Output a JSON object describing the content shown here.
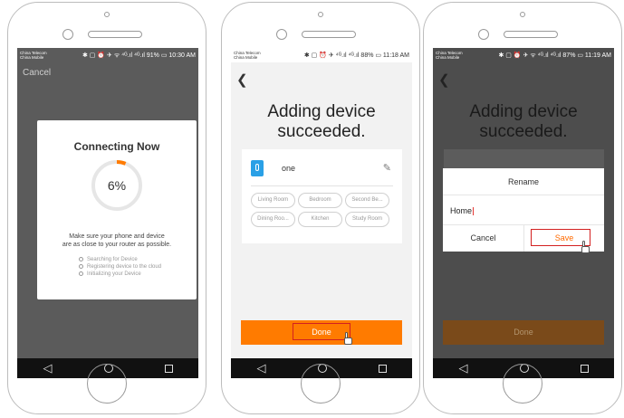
{
  "phone1": {
    "status_carrier": "China Telecom\nChina Mobile",
    "status_right": "✱ ▢ ⏰ ✈ ᯤ ⁴ᴳ.ıl ⁴ᴳ.ıl 91% ▭ 10:30 AM",
    "cancel_label": "Cancel",
    "dialog_title": "Connecting Now",
    "progress_percent": 6,
    "progress_label": "6%",
    "message_line1": "Make sure your phone and device",
    "message_line2": "are as close to your router as possible.",
    "steps": [
      "Searching for Device",
      "Registering device to the cloud",
      "Initializing your Device"
    ]
  },
  "phone2": {
    "status_carrier": "China Telecom\nChina Mobile",
    "status_right": "✱ ▢ ⏰ ✈ ⁴ᴳ.ıl ⁴ᴳ.ıl 88% ▭ 11:18 AM",
    "heading_line1": "Adding device",
    "heading_line2": "succeeded.",
    "device_name": "one",
    "rooms": [
      "Living Room",
      "Bedroom",
      "Second Be...",
      "Dining Roo...",
      "Kitchen",
      "Study Room"
    ],
    "done_label": "Done"
  },
  "phone3": {
    "status_carrier": "China Telecom\nChina Mobile",
    "status_right": "✱ ▢ ⏰ ✈ ᯤ ⁴ᴳ.ıl ⁴ᴳ.ıl 87% ▭ 11:19 AM",
    "heading_line1": "Adding device",
    "heading_line2": "succeeded.",
    "dialog_title": "Rename",
    "input_value": "Home",
    "cancel_label": "Cancel",
    "save_label": "Save",
    "done_label": "Done"
  },
  "colors": {
    "accent": "#ff7b00",
    "highlight": "#d32020",
    "device_icon": "#2aa0e6"
  },
  "icons": [
    "back-arrow-icon",
    "pencil-icon",
    "nav-back-icon",
    "nav-home-icon",
    "nav-recent-icon",
    "hand-pointer-icon"
  ]
}
